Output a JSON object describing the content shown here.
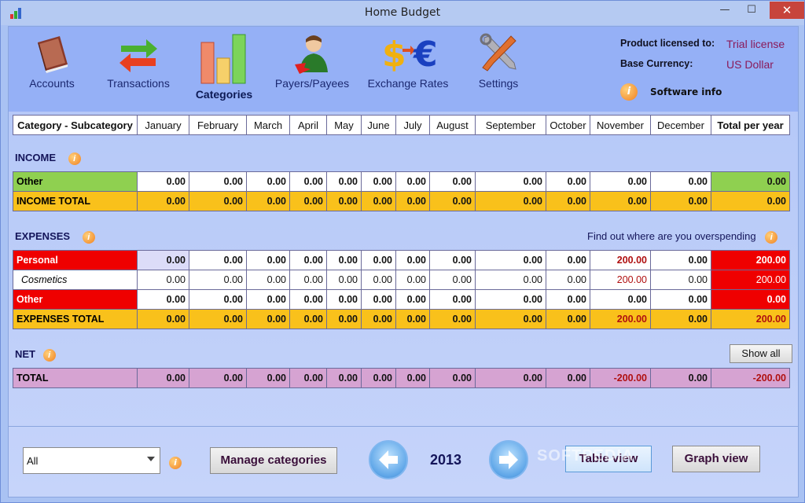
{
  "window": {
    "title": "Home Budget",
    "minimize": "—",
    "maximize": "☐",
    "close": "✕"
  },
  "toolbar": {
    "items": [
      {
        "label": "Accounts",
        "icon": "book-icon"
      },
      {
        "label": "Transactions",
        "icon": "arrows-icon"
      },
      {
        "label": "Categories",
        "icon": "bar-chart-icon",
        "active": true
      },
      {
        "label": "Payers/Payees",
        "icon": "person-icon"
      },
      {
        "label": "Exchange Rates",
        "icon": "currency-icon"
      },
      {
        "label": "Settings",
        "icon": "tools-icon"
      }
    ]
  },
  "license": {
    "licensed_label": "Product licensed to:",
    "licensed_value": "Trial license",
    "currency_label": "Base Currency:",
    "currency_value": "US Dollar",
    "software_info": "Software info"
  },
  "columns": [
    "Category - Subcategory",
    "January",
    "February",
    "March",
    "April",
    "May",
    "June",
    "July",
    "August",
    "September",
    "October",
    "November",
    "December",
    "Total per year"
  ],
  "sections": {
    "income": "INCOME",
    "expenses": "EXPENSES",
    "net": "NET",
    "overspend": "Find out where are you overspending",
    "show_all": "Show all",
    "info_glyph": "i"
  },
  "income_rows": [
    {
      "label": "Other",
      "values": [
        "0.00",
        "0.00",
        "0.00",
        "0.00",
        "0.00",
        "0.00",
        "0.00",
        "0.00",
        "0.00",
        "0.00",
        "0.00",
        "0.00",
        "0.00"
      ]
    },
    {
      "label": "INCOME TOTAL",
      "values": [
        "0.00",
        "0.00",
        "0.00",
        "0.00",
        "0.00",
        "0.00",
        "0.00",
        "0.00",
        "0.00",
        "0.00",
        "0.00",
        "0.00",
        "0.00"
      ]
    }
  ],
  "expense_rows": [
    {
      "label": "Personal",
      "values": [
        "0.00",
        "0.00",
        "0.00",
        "0.00",
        "0.00",
        "0.00",
        "0.00",
        "0.00",
        "0.00",
        "0.00",
        "200.00",
        "0.00",
        "200.00"
      ]
    },
    {
      "label": "Cosmetics",
      "values": [
        "0.00",
        "0.00",
        "0.00",
        "0.00",
        "0.00",
        "0.00",
        "0.00",
        "0.00",
        "0.00",
        "0.00",
        "200.00",
        "0.00",
        "200.00"
      ]
    },
    {
      "label": "Other",
      "values": [
        "0.00",
        "0.00",
        "0.00",
        "0.00",
        "0.00",
        "0.00",
        "0.00",
        "0.00",
        "0.00",
        "0.00",
        "0.00",
        "0.00",
        "0.00"
      ]
    },
    {
      "label": "EXPENSES TOTAL",
      "values": [
        "0.00",
        "0.00",
        "0.00",
        "0.00",
        "0.00",
        "0.00",
        "0.00",
        "0.00",
        "0.00",
        "0.00",
        "200.00",
        "0.00",
        "200.00"
      ]
    }
  ],
  "net_rows": [
    {
      "label": "TOTAL",
      "values": [
        "0.00",
        "0.00",
        "0.00",
        "0.00",
        "0.00",
        "0.00",
        "0.00",
        "0.00",
        "0.00",
        "0.00",
        "-200.00",
        "0.00",
        "-200.00"
      ]
    }
  ],
  "footer": {
    "filter_value": "All",
    "manage_categories": "Manage categories",
    "year": "2013",
    "table_view": "Table view",
    "graph_view": "Graph view",
    "watermark": "SOFTPEDIA"
  },
  "colors": {
    "header_bg": "#95b0f6",
    "income_other": "#8fd050",
    "totals": "#f9c11b",
    "expense_red": "#ef0000",
    "net_pink": "#d6a3d2"
  }
}
